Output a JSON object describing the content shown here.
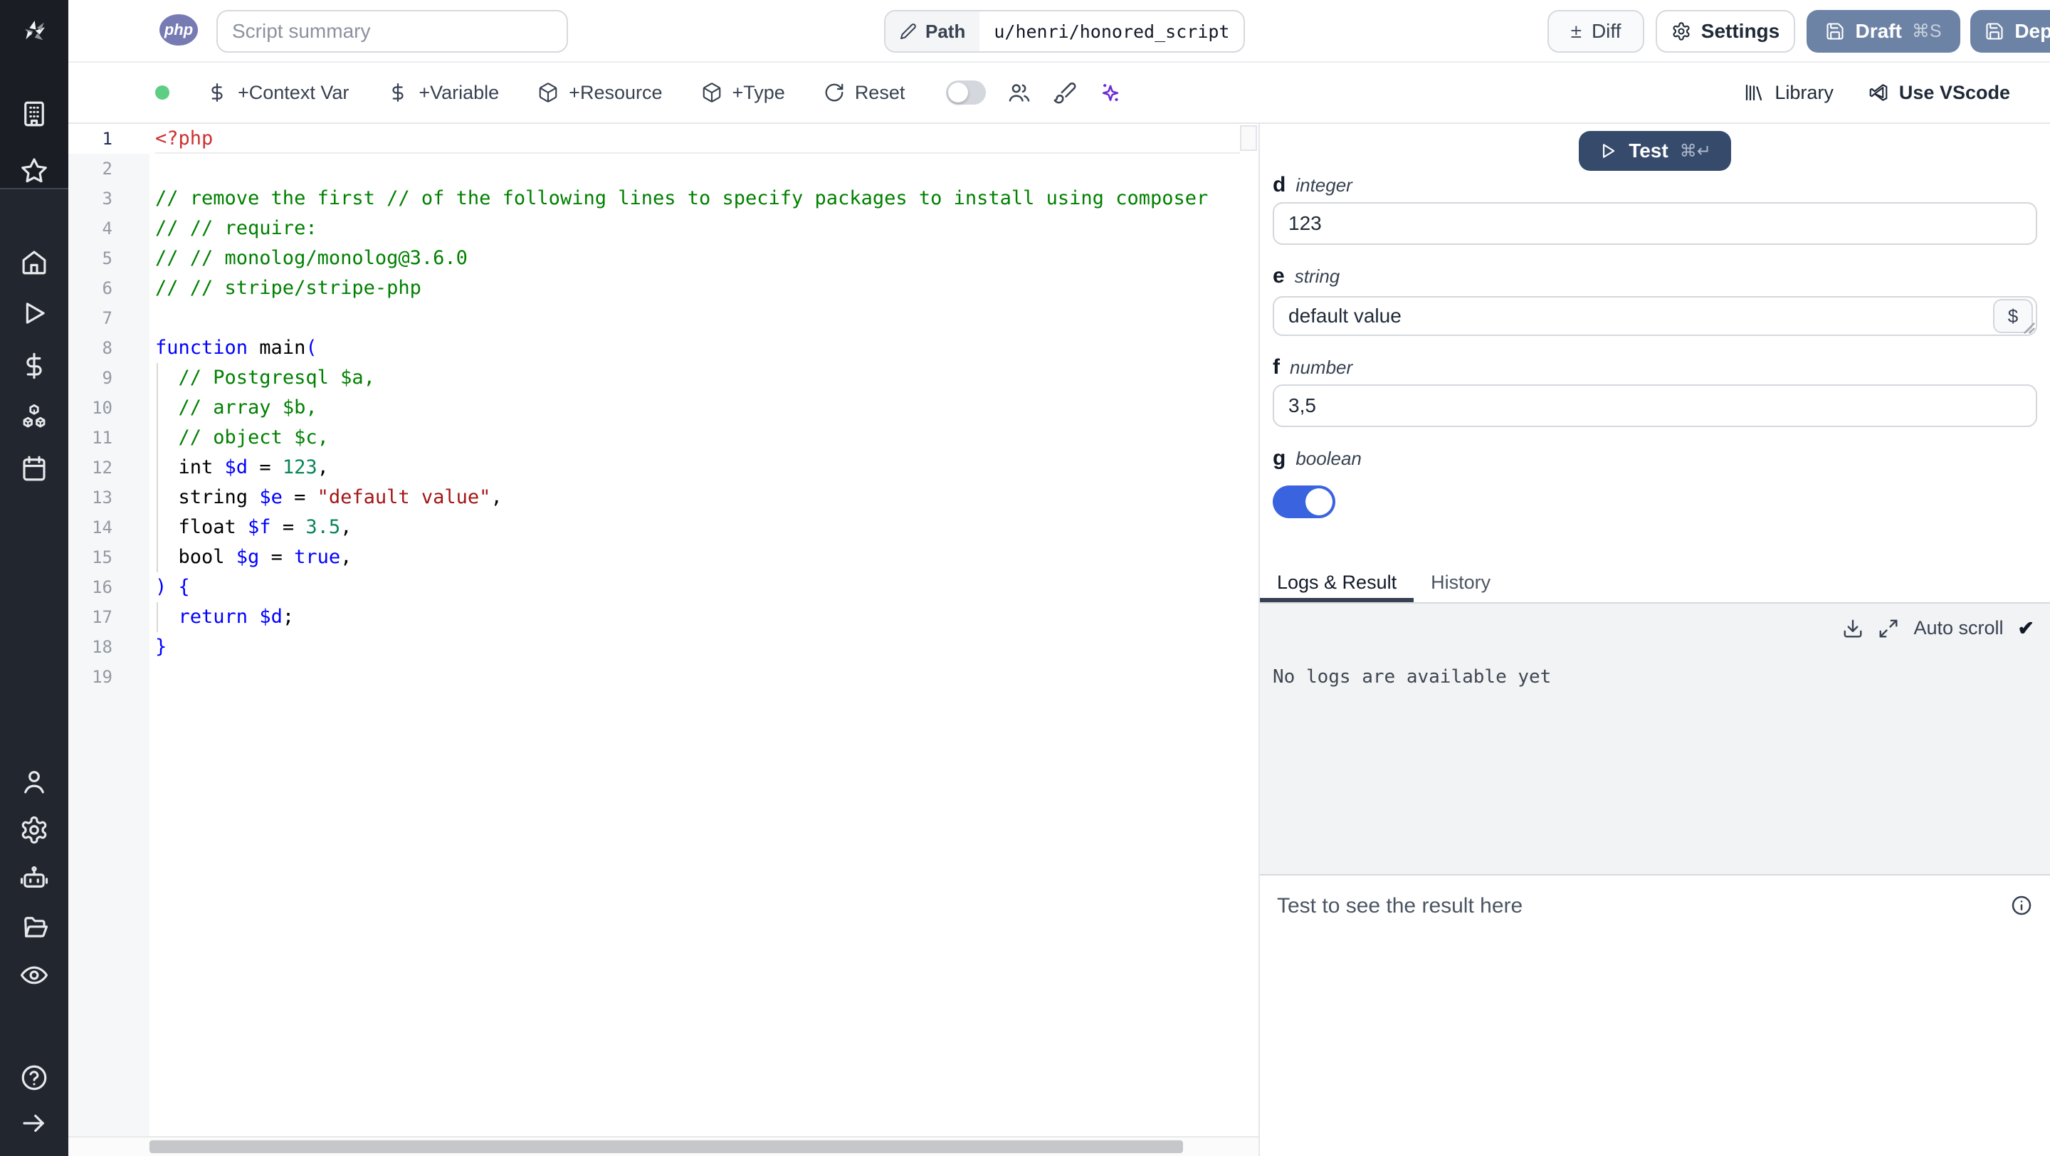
{
  "colors": {
    "accent_blue": "#3a63e0",
    "button_slate": "#6d83a5",
    "test_button": "#364a6b",
    "php_badge": "#777bb4",
    "sparkles": "#6d28d9",
    "status_dot": "#5ece84"
  },
  "header": {
    "language_badge": "php",
    "summary_placeholder": "Script summary",
    "path_label": "Path",
    "path_value": "u/henri/honored_script",
    "diff_label": "Diff",
    "settings_label": "Settings",
    "draft_label": "Draft",
    "draft_shortcut": "⌘S",
    "deploy_label": "Deploy"
  },
  "toolbar": {
    "add_context_var": "+Context Var",
    "add_variable": "+Variable",
    "add_resource": "+Resource",
    "add_type": "+Type",
    "reset_label": "Reset",
    "library_label": "Library",
    "vscode_label": "Use VScode"
  },
  "editor": {
    "language": "php",
    "lines": [
      {
        "n": 1,
        "active": true,
        "tokens": [
          [
            "meta",
            "<?php"
          ]
        ]
      },
      {
        "n": 2,
        "tokens": []
      },
      {
        "n": 3,
        "tokens": [
          [
            "com",
            "// remove the first // of the following lines to specify packages to install using composer"
          ]
        ]
      },
      {
        "n": 4,
        "tokens": [
          [
            "com",
            "// // require:"
          ]
        ]
      },
      {
        "n": 5,
        "tokens": [
          [
            "com",
            "// // monolog/monolog@3.6.0"
          ]
        ]
      },
      {
        "n": 6,
        "tokens": [
          [
            "com",
            "// // stripe/stripe-php"
          ]
        ]
      },
      {
        "n": 7,
        "tokens": []
      },
      {
        "n": 8,
        "tokens": [
          [
            "kw",
            "function"
          ],
          [
            "plain",
            " main"
          ],
          [
            "kw",
            "("
          ]
        ]
      },
      {
        "n": 9,
        "tokens": [
          [
            "plain",
            "  "
          ],
          [
            "com",
            "// Postgresql $a,"
          ]
        ]
      },
      {
        "n": 10,
        "tokens": [
          [
            "plain",
            "  "
          ],
          [
            "com",
            "// array $b,"
          ]
        ]
      },
      {
        "n": 11,
        "tokens": [
          [
            "plain",
            "  "
          ],
          [
            "com",
            "// object $c,"
          ]
        ]
      },
      {
        "n": 12,
        "tokens": [
          [
            "plain",
            "  int "
          ],
          [
            "var",
            "$d"
          ],
          [
            "plain",
            " = "
          ],
          [
            "num",
            "123"
          ],
          [
            "plain",
            ","
          ]
        ]
      },
      {
        "n": 13,
        "tokens": [
          [
            "plain",
            "  string "
          ],
          [
            "var",
            "$e"
          ],
          [
            "plain",
            " = "
          ],
          [
            "str",
            "\"default value\""
          ],
          [
            "plain",
            ","
          ]
        ]
      },
      {
        "n": 14,
        "tokens": [
          [
            "plain",
            "  float "
          ],
          [
            "var",
            "$f"
          ],
          [
            "plain",
            " = "
          ],
          [
            "num",
            "3.5"
          ],
          [
            "plain",
            ","
          ]
        ]
      },
      {
        "n": 15,
        "tokens": [
          [
            "plain",
            "  bool "
          ],
          [
            "var",
            "$g"
          ],
          [
            "plain",
            " = "
          ],
          [
            "kw",
            "true"
          ],
          [
            "plain",
            ","
          ]
        ]
      },
      {
        "n": 16,
        "tokens": [
          [
            "kw",
            ") {"
          ]
        ]
      },
      {
        "n": 17,
        "tokens": [
          [
            "plain",
            "  "
          ],
          [
            "kw",
            "return"
          ],
          [
            "plain",
            " "
          ],
          [
            "var",
            "$d"
          ],
          [
            "plain",
            ";"
          ]
        ]
      },
      {
        "n": 18,
        "tokens": [
          [
            "kw",
            "}"
          ]
        ]
      },
      {
        "n": 19,
        "tokens": []
      }
    ]
  },
  "run_panel": {
    "test_label": "Test",
    "test_shortcut": "⌘↵",
    "fields": [
      {
        "name": "d",
        "type": "integer",
        "value": "123"
      },
      {
        "name": "e",
        "type": "string",
        "value": "default value",
        "currency_button": "$"
      },
      {
        "name": "f",
        "type": "number",
        "value": "3,5"
      },
      {
        "name": "g",
        "type": "boolean",
        "value": true
      }
    ],
    "tabs": [
      "Logs & Result",
      "History"
    ],
    "active_tab": "Logs & Result",
    "auto_scroll_label": "Auto scroll",
    "no_logs_message": "No logs are available yet",
    "result_placeholder": "Test to see the result here"
  }
}
